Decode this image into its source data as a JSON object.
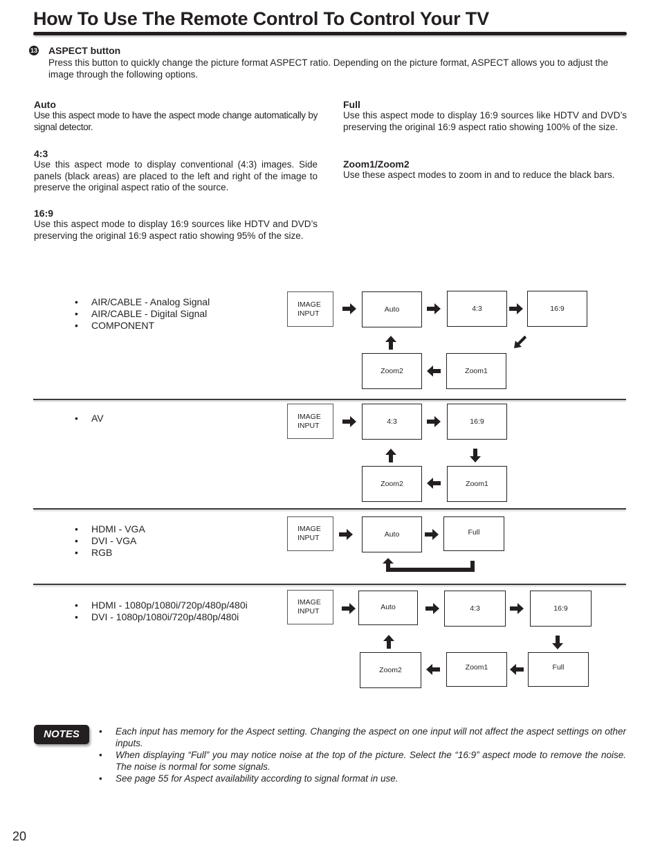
{
  "header": {
    "title": "How To Use The Remote Control To Control Your TV"
  },
  "section": {
    "number": "13",
    "heading": "ASPECT button",
    "description": "Press this button to quickly change the picture format ASPECT ratio. Depending on the  picture format, ASPECT allows you to adjust the image through the following options."
  },
  "modes": {
    "auto": {
      "title": "Auto",
      "text": "Use this aspect mode to have the aspect mode change automatically by signal detector."
    },
    "four_three": {
      "title": "4:3",
      "text": "Use this aspect mode to display conventional (4:3) images. Side panels (black areas) are placed to the left and right of the image to preserve the original aspect ratio of the source."
    },
    "sixteen_nine": {
      "title": "16:9",
      "text": "Use this aspect mode to display 16:9 sources like HDTV and DVD’s preserving the original 16:9 aspect ratio showing 95% of the size."
    },
    "full": {
      "title": "Full",
      "text": "Use this aspect mode to display 16:9 sources like HDTV and DVD’s preserving the original 16:9 aspect ratio showing 100% of the size."
    },
    "zoom": {
      "title": "Zoom1/Zoom2",
      "text": "Use these aspect modes to zoom in and to reduce the black bars."
    }
  },
  "flows": [
    {
      "inputs": [
        "AIR/CABLE - Analog Signal",
        "AIR/CABLE - Digital Signal",
        "COMPONENT"
      ],
      "boxes": {
        "input_line1": "IMAGE",
        "input_line2": "INPUT",
        "b1": "Auto",
        "b2": "4:3",
        "b3": "16:9",
        "b4": "Zoom1",
        "b5": "Zoom2"
      }
    },
    {
      "inputs": [
        "AV"
      ],
      "boxes": {
        "input_line1": "IMAGE",
        "input_line2": "INPUT",
        "b1": "4:3",
        "b2": "16:9",
        "b3": "Zoom1",
        "b4": "Zoom2"
      }
    },
    {
      "inputs": [
        "HDMI - VGA",
        "DVI - VGA",
        "RGB"
      ],
      "boxes": {
        "input_line1": "IMAGE",
        "input_line2": "INPUT",
        "b1": "Auto",
        "b2": "Full"
      }
    },
    {
      "inputs": [
        "HDMI - 1080p/1080i/720p/480p/480i",
        "DVI - 1080p/1080i/720p/480p/480i"
      ],
      "boxes": {
        "input_line1": "IMAGE",
        "input_line2": "INPUT",
        "b1": "Auto",
        "b2": "4:3",
        "b3": "16:9",
        "b4": "Full",
        "b5": "Zoom1",
        "b6": "Zoom2"
      }
    }
  ],
  "notes": {
    "badge": "NOTES",
    "items": [
      "Each input has memory for the Aspect setting. Changing the aspect on one input will not affect the aspect settings on other inputs.",
      "When displaying “Full” you may notice noise at the top of the picture. Select the “16:9” aspect mode to remove the noise. The noise is normal for some signals.",
      "See page 55 for Aspect availability according to signal format in use."
    ]
  },
  "footer": {
    "page_number": "20"
  }
}
